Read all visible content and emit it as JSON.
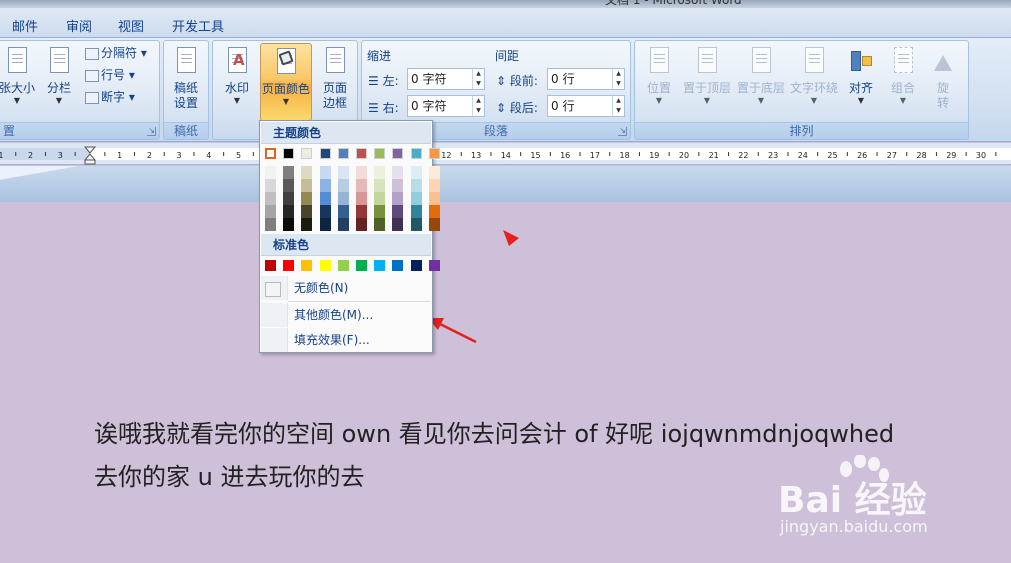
{
  "window": {
    "title": "文档 1 - Microsoft Word"
  },
  "tabs": [
    "邮件",
    "审阅",
    "视图",
    "开发工具"
  ],
  "ribbon": {
    "page_setup": {
      "group_label": "置",
      "size_label": "张大小",
      "columns_label": "分栏",
      "breaks_label": "分隔符",
      "line_numbers_label": "行号",
      "hyphenation_label": "断字"
    },
    "manuscript": {
      "group_label": "稿纸",
      "button_label_1": "稿纸",
      "button_label_2": "设置"
    },
    "page_background": {
      "watermark_label": "水印",
      "page_color_label": "页面颜色",
      "page_borders_label_1": "页面",
      "page_borders_label_2": "边框"
    },
    "paragraph": {
      "group_label": "段落",
      "indent_title": "缩进",
      "spacing_title": "间距",
      "indent_left_label": "左:",
      "indent_left_value": "0 字符",
      "indent_right_label": "右:",
      "indent_right_value": "0 字符",
      "spacing_before_label": "段前:",
      "spacing_before_value": "0 行",
      "spacing_after_label": "段后:",
      "spacing_after_value": "0 行"
    },
    "arrange": {
      "group_label": "排列",
      "position_label": "位置",
      "bring_front_label": "置于顶层",
      "send_back_label": "置于底层",
      "text_wrap_label": "文字环绕",
      "align_label": "对齐",
      "group_obj_label": "组合",
      "rotate_label_1": "旋",
      "rotate_label_2": "转"
    }
  },
  "ruler": {
    "left_ticks": [
      "3",
      "2",
      "1"
    ],
    "right_ticks": [
      "1",
      "2",
      "3",
      "4",
      "5",
      "6",
      "7",
      "8",
      "9",
      "10",
      "11",
      "12",
      "13",
      "14",
      "15",
      "16",
      "17",
      "18",
      "19",
      "20",
      "21",
      "22",
      "23",
      "24",
      "25",
      "26",
      "27",
      "28",
      "29",
      "30"
    ]
  },
  "color_menu": {
    "theme_heading": "主题颜色",
    "standard_heading": "标准色",
    "no_color": "无颜色(N)",
    "more_colors": "其他颜色(M)...",
    "fill_effects": "填充效果(F)...",
    "theme_top": [
      "#ffffff",
      "#000000",
      "#eeece1",
      "#1f497d",
      "#4f81bd",
      "#c0504d",
      "#9bbb59",
      "#8064a2",
      "#4bacc6",
      "#f79646"
    ],
    "theme_shades": [
      [
        "#f2f2f2",
        "#d8d8d8",
        "#bfbfbf",
        "#a5a5a5",
        "#7f7f7f"
      ],
      [
        "#7f7f7f",
        "#595959",
        "#3f3f3f",
        "#262626",
        "#0c0c0c"
      ],
      [
        "#ddd9c3",
        "#c4bd97",
        "#938953",
        "#494429",
        "#1d1b10"
      ],
      [
        "#c6d9f0",
        "#8db3e2",
        "#548dd4",
        "#17365d",
        "#0f243e"
      ],
      [
        "#dbe5f1",
        "#b8cce4",
        "#95b3d7",
        "#366092",
        "#244061"
      ],
      [
        "#f2dcdb",
        "#e5b9b7",
        "#d99694",
        "#953734",
        "#632423"
      ],
      [
        "#ebf1dd",
        "#d7e3bc",
        "#c3d69b",
        "#76923c",
        "#4f6128"
      ],
      [
        "#e5e0ec",
        "#ccc1d9",
        "#b2a2c7",
        "#5f497a",
        "#3f3151"
      ],
      [
        "#dbeef3",
        "#b7dde8",
        "#92cddc",
        "#31859b",
        "#205867"
      ],
      [
        "#fdeada",
        "#fbd5b5",
        "#fac08f",
        "#e36c09",
        "#974806"
      ]
    ],
    "standard": [
      "#c00000",
      "#ff0000",
      "#ffc000",
      "#ffff00",
      "#92d050",
      "#00b050",
      "#00b0f0",
      "#0070c0",
      "#002060",
      "#7030a0"
    ]
  },
  "document": {
    "page_color": "#cdc0d8",
    "line1": "诶哦我就看完你的空间 own 看见你去问会计 of 好呢 iojqwnmdnjoqwhed",
    "line2": "去你的家 u 进去玩你的去"
  },
  "annotation": {
    "arrow_color": "#e8201c"
  },
  "watermark": {
    "logo": "Bai 经验",
    "url": "jingyan.baidu.com"
  }
}
